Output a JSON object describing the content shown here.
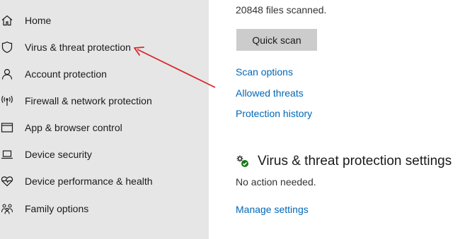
{
  "sidebar": {
    "items": [
      {
        "label": "Home",
        "icon": "home-icon"
      },
      {
        "label": "Virus & threat protection",
        "icon": "shield-icon"
      },
      {
        "label": "Account protection",
        "icon": "person-icon"
      },
      {
        "label": "Firewall & network protection",
        "icon": "wireless-icon"
      },
      {
        "label": "App & browser control",
        "icon": "browser-window-icon"
      },
      {
        "label": "Device security",
        "icon": "laptop-icon"
      },
      {
        "label": "Device performance & health",
        "icon": "heart-pulse-icon"
      },
      {
        "label": "Family options",
        "icon": "family-icon"
      }
    ]
  },
  "main": {
    "files_scanned": "20848 files scanned.",
    "quick_scan_label": "Quick scan",
    "links": {
      "scan_options": "Scan options",
      "allowed_threats": "Allowed threats",
      "protection_history": "Protection history"
    },
    "settings_section": {
      "title": "Virus & threat protection settings",
      "icon": "settings-gears-icon",
      "status": "No action needed.",
      "manage_link": "Manage settings"
    }
  },
  "colors": {
    "sidebar_bg": "#e6e6e6",
    "link": "#0067b8",
    "button_bg": "#cccccc",
    "annotation_arrow": "#d9262b",
    "status_ok": "#107c10"
  }
}
